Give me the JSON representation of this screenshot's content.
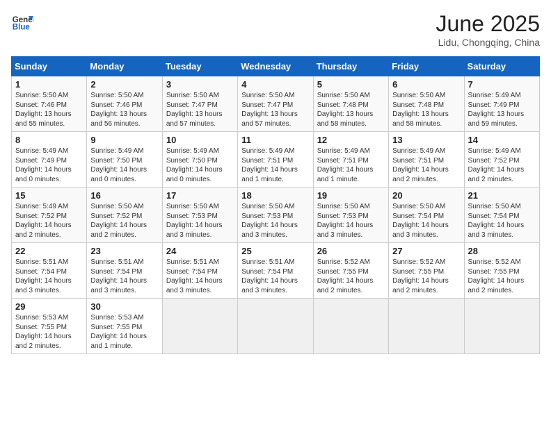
{
  "header": {
    "logo_general": "General",
    "logo_blue": "Blue",
    "month_year": "June 2025",
    "location": "Lidu, Chongqing, China"
  },
  "weekdays": [
    "Sunday",
    "Monday",
    "Tuesday",
    "Wednesday",
    "Thursday",
    "Friday",
    "Saturday"
  ],
  "weeks": [
    [
      {
        "day": "1",
        "sunrise": "5:50 AM",
        "sunset": "7:46 PM",
        "daylight": "13 hours and 55 minutes."
      },
      {
        "day": "2",
        "sunrise": "5:50 AM",
        "sunset": "7:46 PM",
        "daylight": "13 hours and 56 minutes."
      },
      {
        "day": "3",
        "sunrise": "5:50 AM",
        "sunset": "7:47 PM",
        "daylight": "13 hours and 57 minutes."
      },
      {
        "day": "4",
        "sunrise": "5:50 AM",
        "sunset": "7:47 PM",
        "daylight": "13 hours and 57 minutes."
      },
      {
        "day": "5",
        "sunrise": "5:50 AM",
        "sunset": "7:48 PM",
        "daylight": "13 hours and 58 minutes."
      },
      {
        "day": "6",
        "sunrise": "5:50 AM",
        "sunset": "7:48 PM",
        "daylight": "13 hours and 58 minutes."
      },
      {
        "day": "7",
        "sunrise": "5:49 AM",
        "sunset": "7:49 PM",
        "daylight": "13 hours and 59 minutes."
      }
    ],
    [
      {
        "day": "8",
        "sunrise": "5:49 AM",
        "sunset": "7:49 PM",
        "daylight": "14 hours and 0 minutes."
      },
      {
        "day": "9",
        "sunrise": "5:49 AM",
        "sunset": "7:50 PM",
        "daylight": "14 hours and 0 minutes."
      },
      {
        "day": "10",
        "sunrise": "5:49 AM",
        "sunset": "7:50 PM",
        "daylight": "14 hours and 0 minutes."
      },
      {
        "day": "11",
        "sunrise": "5:49 AM",
        "sunset": "7:51 PM",
        "daylight": "14 hours and 1 minute."
      },
      {
        "day": "12",
        "sunrise": "5:49 AM",
        "sunset": "7:51 PM",
        "daylight": "14 hours and 1 minute."
      },
      {
        "day": "13",
        "sunrise": "5:49 AM",
        "sunset": "7:51 PM",
        "daylight": "14 hours and 2 minutes."
      },
      {
        "day": "14",
        "sunrise": "5:49 AM",
        "sunset": "7:52 PM",
        "daylight": "14 hours and 2 minutes."
      }
    ],
    [
      {
        "day": "15",
        "sunrise": "5:49 AM",
        "sunset": "7:52 PM",
        "daylight": "14 hours and 2 minutes."
      },
      {
        "day": "16",
        "sunrise": "5:50 AM",
        "sunset": "7:52 PM",
        "daylight": "14 hours and 2 minutes."
      },
      {
        "day": "17",
        "sunrise": "5:50 AM",
        "sunset": "7:53 PM",
        "daylight": "14 hours and 3 minutes."
      },
      {
        "day": "18",
        "sunrise": "5:50 AM",
        "sunset": "7:53 PM",
        "daylight": "14 hours and 3 minutes."
      },
      {
        "day": "19",
        "sunrise": "5:50 AM",
        "sunset": "7:53 PM",
        "daylight": "14 hours and 3 minutes."
      },
      {
        "day": "20",
        "sunrise": "5:50 AM",
        "sunset": "7:54 PM",
        "daylight": "14 hours and 3 minutes."
      },
      {
        "day": "21",
        "sunrise": "5:50 AM",
        "sunset": "7:54 PM",
        "daylight": "14 hours and 3 minutes."
      }
    ],
    [
      {
        "day": "22",
        "sunrise": "5:51 AM",
        "sunset": "7:54 PM",
        "daylight": "14 hours and 3 minutes."
      },
      {
        "day": "23",
        "sunrise": "5:51 AM",
        "sunset": "7:54 PM",
        "daylight": "14 hours and 3 minutes."
      },
      {
        "day": "24",
        "sunrise": "5:51 AM",
        "sunset": "7:54 PM",
        "daylight": "14 hours and 3 minutes."
      },
      {
        "day": "25",
        "sunrise": "5:51 AM",
        "sunset": "7:54 PM",
        "daylight": "14 hours and 3 minutes."
      },
      {
        "day": "26",
        "sunrise": "5:52 AM",
        "sunset": "7:55 PM",
        "daylight": "14 hours and 2 minutes."
      },
      {
        "day": "27",
        "sunrise": "5:52 AM",
        "sunset": "7:55 PM",
        "daylight": "14 hours and 2 minutes."
      },
      {
        "day": "28",
        "sunrise": "5:52 AM",
        "sunset": "7:55 PM",
        "daylight": "14 hours and 2 minutes."
      }
    ],
    [
      {
        "day": "29",
        "sunrise": "5:53 AM",
        "sunset": "7:55 PM",
        "daylight": "14 hours and 2 minutes."
      },
      {
        "day": "30",
        "sunrise": "5:53 AM",
        "sunset": "7:55 PM",
        "daylight": "14 hours and 1 minute."
      },
      null,
      null,
      null,
      null,
      null
    ]
  ]
}
